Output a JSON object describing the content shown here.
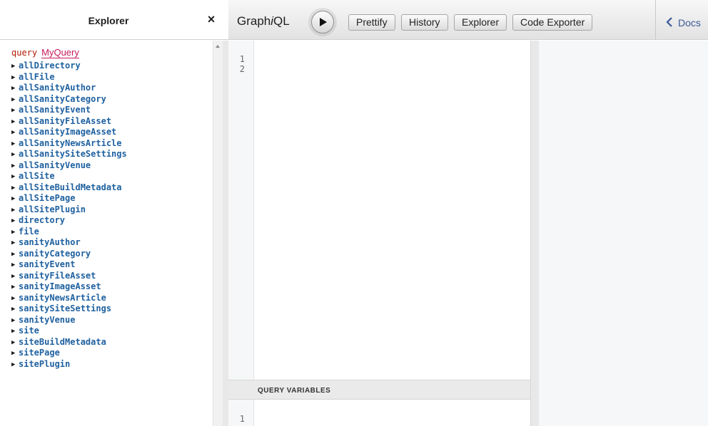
{
  "explorer": {
    "title": "Explorer",
    "close_label": "×",
    "query_keyword": "query",
    "query_name": "MyQuery",
    "fields": [
      "allDirectory",
      "allFile",
      "allSanityAuthor",
      "allSanityCategory",
      "allSanityEvent",
      "allSanityFileAsset",
      "allSanityImageAsset",
      "allSanityNewsArticle",
      "allSanitySiteSettings",
      "allSanityVenue",
      "allSite",
      "allSiteBuildMetadata",
      "allSitePage",
      "allSitePlugin",
      "directory",
      "file",
      "sanityAuthor",
      "sanityCategory",
      "sanityEvent",
      "sanityFileAsset",
      "sanityImageAsset",
      "sanityNewsArticle",
      "sanitySiteSettings",
      "sanityVenue",
      "site",
      "siteBuildMetadata",
      "sitePage",
      "sitePlugin"
    ]
  },
  "toolbar": {
    "logo_prefix": "Graph",
    "logo_italic": "i",
    "logo_suffix": "QL",
    "prettify_label": "Prettify",
    "history_label": "History",
    "explorer_label": "Explorer",
    "code_exporter_label": "Code Exporter",
    "docs_label": "Docs"
  },
  "editor": {
    "line_numbers": [
      "1",
      "2"
    ],
    "variables_title": "QUERY VARIABLES",
    "variables_line_numbers": [
      "1"
    ]
  },
  "colors": {
    "field": "#1f61a0",
    "query_keyword": "#b11a04",
    "query_name": "#c41a5a",
    "docs_link": "#3b5998"
  }
}
